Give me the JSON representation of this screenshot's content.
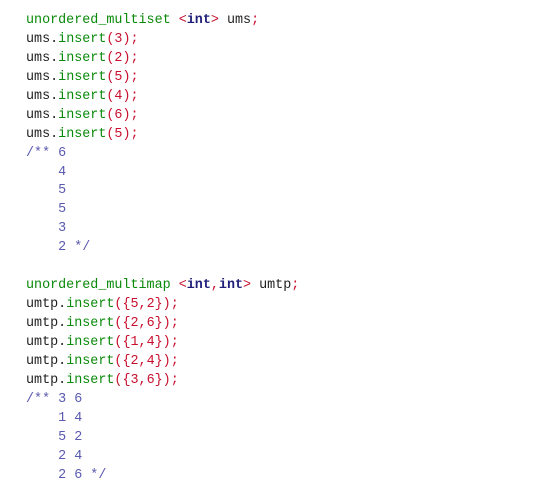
{
  "colors": {
    "type_name": "#0a8a0a",
    "method": "#0a8a0a",
    "punctuation": "#c8102e",
    "keyword": "#1f1f7a",
    "identifier": "#222222",
    "comment": "#5a5ab0"
  },
  "multiset_block": {
    "declaration": {
      "type_name": "unordered_multiset",
      "lt": "<",
      "template_arg": "int",
      "gt": ">",
      "variable": "ums",
      "semicolon": ";"
    },
    "inserts": [
      {
        "object": "ums",
        "dot": ".",
        "method": "insert",
        "open": "(",
        "arg": "3",
        "close": ")",
        "semicolon": ";"
      },
      {
        "object": "ums",
        "dot": ".",
        "method": "insert",
        "open": "(",
        "arg": "2",
        "close": ")",
        "semicolon": ";"
      },
      {
        "object": "ums",
        "dot": ".",
        "method": "insert",
        "open": "(",
        "arg": "5",
        "close": ")",
        "semicolon": ";"
      },
      {
        "object": "ums",
        "dot": ".",
        "method": "insert",
        "open": "(",
        "arg": "4",
        "close": ")",
        "semicolon": ";"
      },
      {
        "object": "ums",
        "dot": ".",
        "method": "insert",
        "open": "(",
        "arg": "6",
        "close": ")",
        "semicolon": ";"
      },
      {
        "object": "ums",
        "dot": ".",
        "method": "insert",
        "open": "(",
        "arg": "5",
        "close": ")",
        "semicolon": ";"
      }
    ],
    "output_comment": [
      "/** 6",
      "    4",
      "    5",
      "    5",
      "    3",
      "    2 */"
    ]
  },
  "multimap_block": {
    "declaration": {
      "type_name": "unordered_multimap",
      "lt": "<",
      "template_arg_1": "int",
      "comma": ",",
      "template_arg_2": "int",
      "gt": ">",
      "variable": "umtp",
      "semicolon": ";"
    },
    "inserts": [
      {
        "object": "umtp",
        "dot": ".",
        "method": "insert",
        "open": "({",
        "k": "5",
        "comma": ",",
        "v": "2",
        "close": "})",
        "semicolon": ";"
      },
      {
        "object": "umtp",
        "dot": ".",
        "method": "insert",
        "open": "({",
        "k": "2",
        "comma": ",",
        "v": "6",
        "close": "})",
        "semicolon": ";"
      },
      {
        "object": "umtp",
        "dot": ".",
        "method": "insert",
        "open": "({",
        "k": "1",
        "comma": ",",
        "v": "4",
        "close": "})",
        "semicolon": ";"
      },
      {
        "object": "umtp",
        "dot": ".",
        "method": "insert",
        "open": "({",
        "k": "2",
        "comma": ",",
        "v": "4",
        "close": "})",
        "semicolon": ";"
      },
      {
        "object": "umtp",
        "dot": ".",
        "method": "insert",
        "open": "({",
        "k": "3",
        "comma": ",",
        "v": "6",
        "close": "})",
        "semicolon": ";"
      }
    ],
    "output_comment": [
      "/** 3 6",
      "    1 4",
      "    5 2",
      "    2 4",
      "    2 6 */"
    ]
  }
}
